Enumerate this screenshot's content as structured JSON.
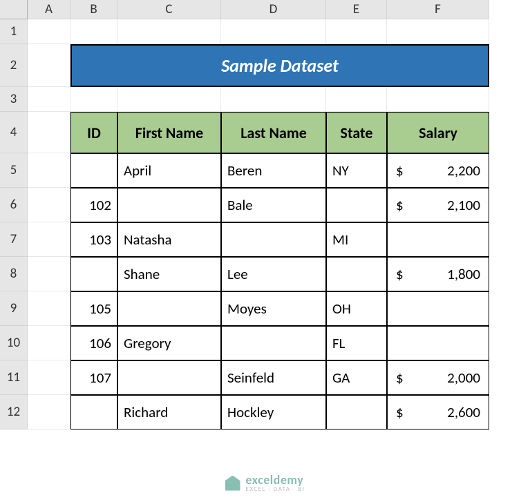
{
  "columns": [
    "A",
    "B",
    "C",
    "D",
    "E",
    "F"
  ],
  "rows": [
    "1",
    "2",
    "3",
    "4",
    "5",
    "6",
    "7",
    "8",
    "9",
    "10",
    "11",
    "12"
  ],
  "title": "Sample Dataset",
  "headers": {
    "id": "ID",
    "first": "First Name",
    "last": "Last Name",
    "state": "State",
    "salary": "Salary"
  },
  "currency": "$",
  "data": [
    {
      "id": "",
      "first": "April",
      "last": "Beren",
      "state": "NY",
      "salary": "2,200"
    },
    {
      "id": "102",
      "first": "",
      "last": "Bale",
      "state": "",
      "salary": "2,100"
    },
    {
      "id": "103",
      "first": "Natasha",
      "last": "",
      "state": "MI",
      "salary": ""
    },
    {
      "id": "",
      "first": "Shane",
      "last": "Lee",
      "state": "",
      "salary": "1,800"
    },
    {
      "id": "105",
      "first": "",
      "last": "Moyes",
      "state": "OH",
      "salary": ""
    },
    {
      "id": "106",
      "first": "Gregory",
      "last": "",
      "state": "FL",
      "salary": ""
    },
    {
      "id": "107",
      "first": "",
      "last": "Seinfeld",
      "state": "GA",
      "salary": "2,000"
    },
    {
      "id": "",
      "first": "Richard",
      "last": "Hockley",
      "state": "",
      "salary": "2,600"
    }
  ],
  "watermark": {
    "brand": "exceldemy",
    "tag": "EXCEL · DATA · BI"
  }
}
